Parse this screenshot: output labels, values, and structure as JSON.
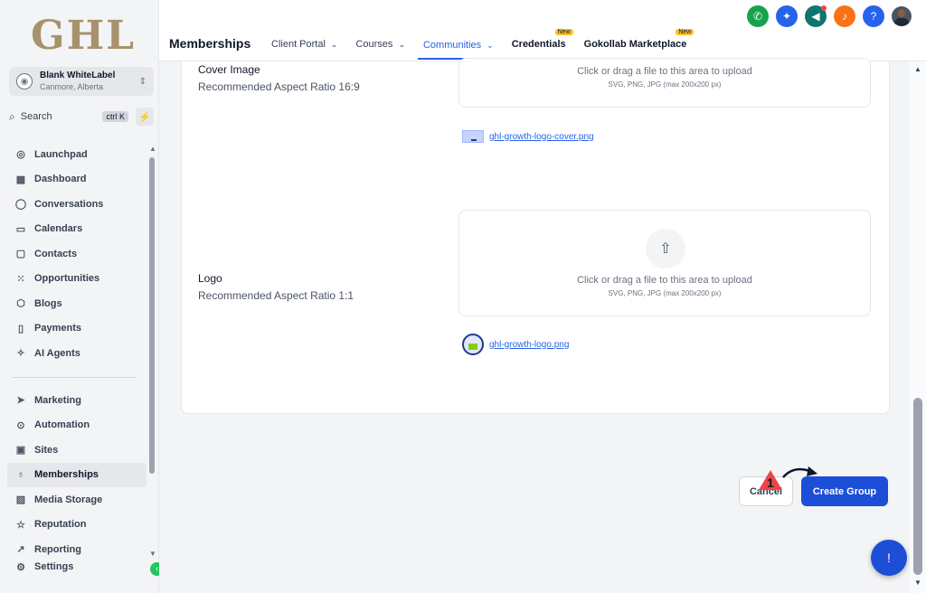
{
  "brand": {
    "logo_text": "GHL"
  },
  "account": {
    "name": "Blank WhiteLabel",
    "location": "Canmore, Alberta"
  },
  "search": {
    "label": "Search",
    "shortcut": "ctrl K"
  },
  "sidebar": {
    "items": [
      {
        "label": "Launchpad",
        "icon": "rocket-icon",
        "glyph": "◎"
      },
      {
        "label": "Dashboard",
        "icon": "dashboard-icon",
        "glyph": "▦"
      },
      {
        "label": "Conversations",
        "icon": "chat-icon",
        "glyph": "◯"
      },
      {
        "label": "Calendars",
        "icon": "calendar-icon",
        "glyph": "▭"
      },
      {
        "label": "Contacts",
        "icon": "contacts-icon",
        "glyph": "▢"
      },
      {
        "label": "Opportunities",
        "icon": "opportunities-icon",
        "glyph": "⁙"
      },
      {
        "label": "Blogs",
        "icon": "blog-icon",
        "glyph": "⬡"
      },
      {
        "label": "Payments",
        "icon": "payments-icon",
        "glyph": "▯"
      },
      {
        "label": "AI Agents",
        "icon": "sparkle-icon",
        "glyph": "✧"
      }
    ],
    "items2": [
      {
        "label": "Marketing",
        "icon": "send-icon",
        "glyph": "➤"
      },
      {
        "label": "Automation",
        "icon": "automation-icon",
        "glyph": "⊙"
      },
      {
        "label": "Sites",
        "icon": "sites-icon",
        "glyph": "▣"
      },
      {
        "label": "Memberships",
        "icon": "award-icon",
        "glyph": "♁"
      },
      {
        "label": "Media Storage",
        "icon": "image-icon",
        "glyph": "▨"
      },
      {
        "label": "Reputation",
        "icon": "star-icon",
        "glyph": "☆"
      },
      {
        "label": "Reporting",
        "icon": "chart-icon",
        "glyph": "↗"
      }
    ],
    "settings": {
      "label": "Settings",
      "icon": "gear-icon",
      "glyph": "⚙"
    }
  },
  "header": {
    "title": "Memberships",
    "tabs": [
      {
        "label": "Client Portal",
        "chevron": "⌄"
      },
      {
        "label": "Courses",
        "chevron": "⌄"
      },
      {
        "label": "Communities",
        "chevron": "⌄"
      },
      {
        "label": "Credentials",
        "badge": "New"
      },
      {
        "label": "Gokollab Marketplace",
        "badge": "New"
      }
    ],
    "icons": [
      {
        "name": "phone-icon",
        "glyph": "✆",
        "color": "#16a34a"
      },
      {
        "name": "magic-icon",
        "glyph": "✦",
        "color": "#2563eb"
      },
      {
        "name": "megaphone-icon",
        "glyph": "◀",
        "color": "#0f766e"
      },
      {
        "name": "bell-icon",
        "glyph": "♪",
        "color": "#f97316"
      },
      {
        "name": "help-icon",
        "glyph": "?",
        "color": "#2563eb"
      }
    ]
  },
  "form": {
    "cover": {
      "label": "Cover Image",
      "hint": "Recommended Aspect Ratio 16:9",
      "drop_text": "Click or drag a file to this area to upload",
      "drop_sub": "SVG, PNG, JPG (max 200x200 px)",
      "file_name": "ghl-growth-logo-cover.png"
    },
    "logo": {
      "label": "Logo",
      "hint": "Recommended Aspect Ratio 1:1",
      "drop_text": "Click or drag a file to this area to upload",
      "drop_sub": "SVG, PNG, JPG (max 200x200 px)",
      "file_name": "ghl-growth-logo.png"
    }
  },
  "actions": {
    "cancel": "Cancel",
    "create": "Create Group",
    "step_number": "1"
  },
  "colors": {
    "accent": "#2563eb",
    "primary_button": "#1d4ed8",
    "sidebar_bg": "#f3f4f6",
    "logo": "#a8926d"
  }
}
